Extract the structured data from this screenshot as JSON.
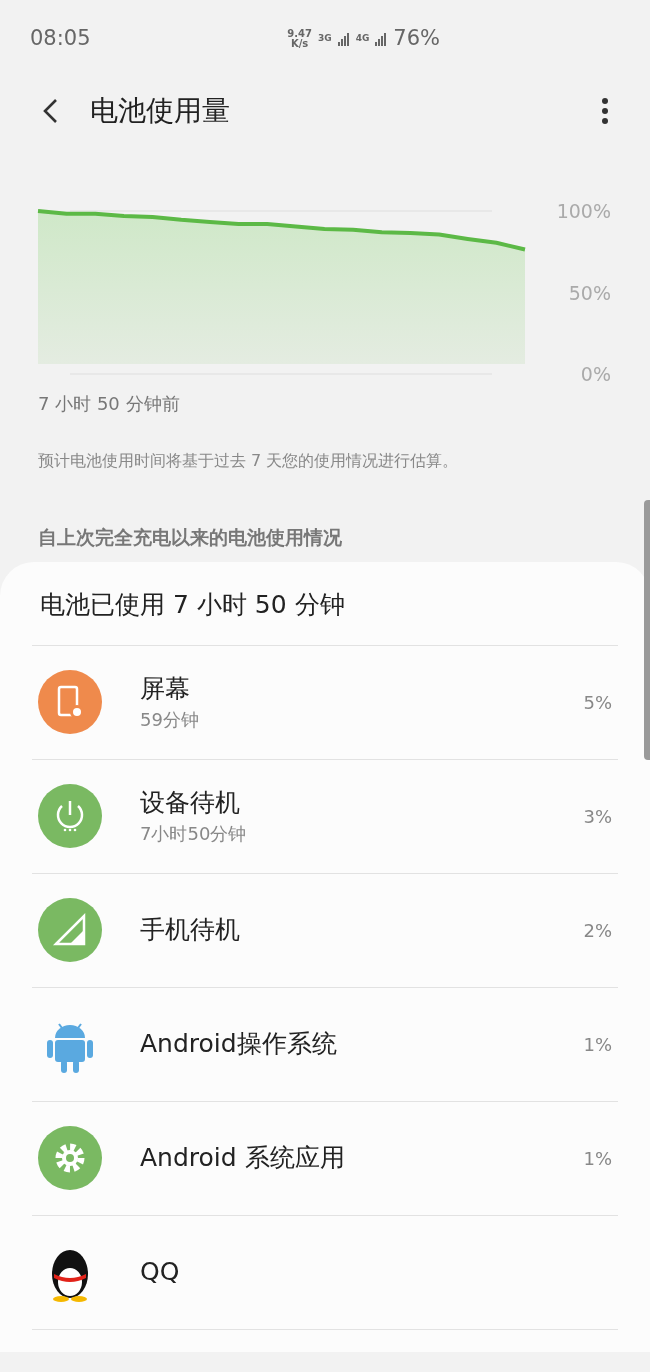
{
  "status_bar": {
    "time": "08:05",
    "speed_value": "9.47",
    "speed_unit": "K/s",
    "net_1": "3G",
    "net_2": "4G",
    "battery": "76%"
  },
  "app_bar": {
    "title": "电池使用量"
  },
  "chart": {
    "axis_labels": [
      "100%",
      "50%",
      "0%"
    ],
    "start_label": "7 小时 50 分钟前"
  },
  "note": "预计电池使用时间将基于过去 7 天您的使用情况进行估算。",
  "section_title": "自上次完全充电以来的电池使用情况",
  "usage": {
    "total": "电池已使用 7 小时 50 分钟",
    "items": [
      {
        "kind": "screen",
        "name": "屏幕",
        "detail": "59分钟",
        "percent": "5%"
      },
      {
        "kind": "idle",
        "name": "设备待机",
        "detail": "7小时50分钟",
        "percent": "3%"
      },
      {
        "kind": "signal",
        "name": "手机待机",
        "percent": "2%"
      },
      {
        "kind": "android",
        "name": "Android操作系统",
        "percent": "1%"
      },
      {
        "kind": "gear",
        "name": "Android 系统应用",
        "percent": "1%"
      },
      {
        "kind": "penguin",
        "name": "QQ"
      }
    ]
  }
}
